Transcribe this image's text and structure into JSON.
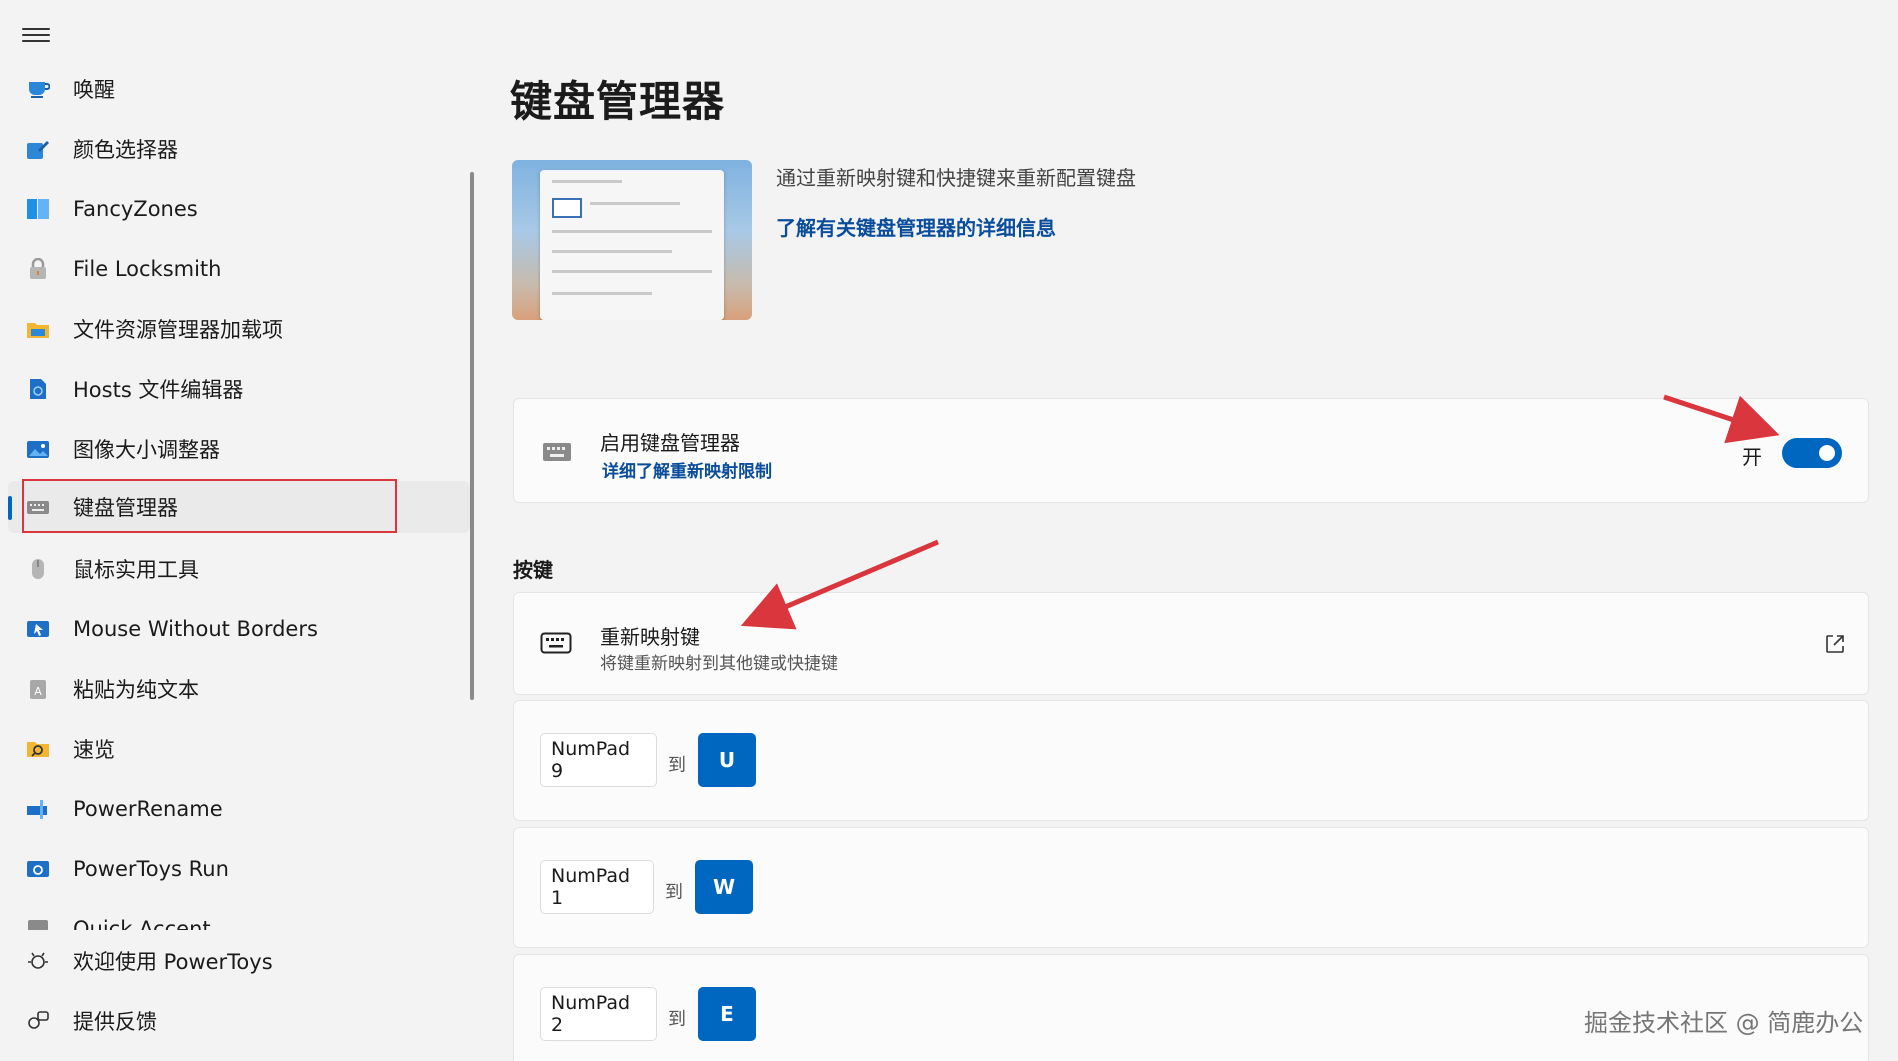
{
  "sidebar": {
    "items": [
      {
        "label": "唤醒",
        "icon": "awake-icon"
      },
      {
        "label": "颜色选择器",
        "icon": "color-picker-icon"
      },
      {
        "label": "FancyZones",
        "icon": "fancyzones-icon"
      },
      {
        "label": "File Locksmith",
        "icon": "lock-icon"
      },
      {
        "label": "文件资源管理器加载项",
        "icon": "folder-icon"
      },
      {
        "label": "Hosts 文件编辑器",
        "icon": "hosts-file-icon"
      },
      {
        "label": "图像大小调整器",
        "icon": "image-resizer-icon"
      },
      {
        "label": "键盘管理器",
        "icon": "keyboard-icon",
        "active": true
      },
      {
        "label": "鼠标实用工具",
        "icon": "mouse-icon"
      },
      {
        "label": "Mouse Without Borders",
        "icon": "mouse-without-borders-icon"
      },
      {
        "label": "粘贴为纯文本",
        "icon": "paste-plain-icon"
      },
      {
        "label": "速览",
        "icon": "peek-icon"
      },
      {
        "label": "PowerRename",
        "icon": "power-rename-icon"
      },
      {
        "label": "PowerToys Run",
        "icon": "powertoys-run-icon"
      },
      {
        "label": "Quick Accent",
        "icon": "quick-accent-icon"
      }
    ],
    "footer": [
      {
        "label": "欢迎使用 PowerToys",
        "icon": "welcome-icon"
      },
      {
        "label": "提供反馈",
        "icon": "feedback-icon"
      }
    ]
  },
  "main": {
    "title": "键盘管理器",
    "description": "通过重新映射键和快捷键来重新配置键盘",
    "learn_more": "了解有关键盘管理器的详细信息",
    "enable_card": {
      "title": "启用键盘管理器",
      "link": "详细了解重新映射限制",
      "toggle_label": "开",
      "toggle_on": true
    },
    "section_keys": "按键",
    "remap_card": {
      "title": "重新映射键",
      "description": "将键重新映射到其他键或快捷键"
    },
    "to_label": "到",
    "mappings": [
      {
        "from": "NumPad 9",
        "to": "U"
      },
      {
        "from": "NumPad 1",
        "to": "W"
      },
      {
        "from": "NumPad 2",
        "to": "E"
      }
    ]
  },
  "watermark": "掘金技术社区 @ 简鹿办公",
  "colors": {
    "accent": "#0067c0",
    "annotation_red": "#d9363e",
    "link": "#0a4d9c"
  }
}
